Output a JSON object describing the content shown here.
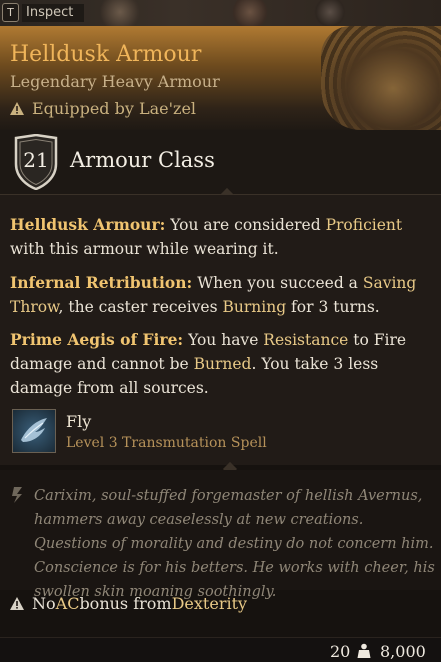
{
  "topbar": {
    "key": "T",
    "label": "Inspect"
  },
  "item": {
    "name": "Helldusk Armour",
    "rarity_type": "Legendary Heavy Armour",
    "equipped": "Equipped by Lae'zel"
  },
  "armour_class": {
    "value": "21",
    "label": "Armour Class"
  },
  "passives": [
    {
      "name": "Helldusk Armour:",
      "text_before": " You are considered ",
      "keyword": "Proficient",
      "text_after": " with this armour while wearing it."
    },
    {
      "name": "Infernal Retribution:",
      "t1": " When you succeed a ",
      "k1": "Saving Throw",
      "t2": ", the caster receives ",
      "k2": "Burning",
      "t3": " for 3 turns."
    },
    {
      "name": "Prime Aegis of Fire:",
      "t1": " You have ",
      "k1": "Resistance",
      "t2": " to Fire damage and cannot be ",
      "k2": "Burned",
      "t3": ". You take 3 less damage from all sources."
    }
  ],
  "spell": {
    "name": "Fly",
    "type": "Level 3 Transmutation Spell"
  },
  "lore": "Carixim, soul-stuffed forgemaster of hellish Avernus, hammers away ceaselessly at new creations. Questions of morality and destiny do not concern him. Conscience is for his betters. He works with cheer, his swollen skin moaning soothingly.",
  "restriction": {
    "t1": "No ",
    "k1": "AC",
    "t2": " bonus from ",
    "k2": "Dexterity"
  },
  "footer": {
    "weight": "20",
    "gold": "8,000"
  },
  "colors": {
    "title": "#f0b55a",
    "keyword": "#e8c987",
    "rarity": "#c7b08a"
  },
  "icons": [
    "warning-icon",
    "shield-icon",
    "fly-spell-icon",
    "quill-icon",
    "weight-icon"
  ]
}
